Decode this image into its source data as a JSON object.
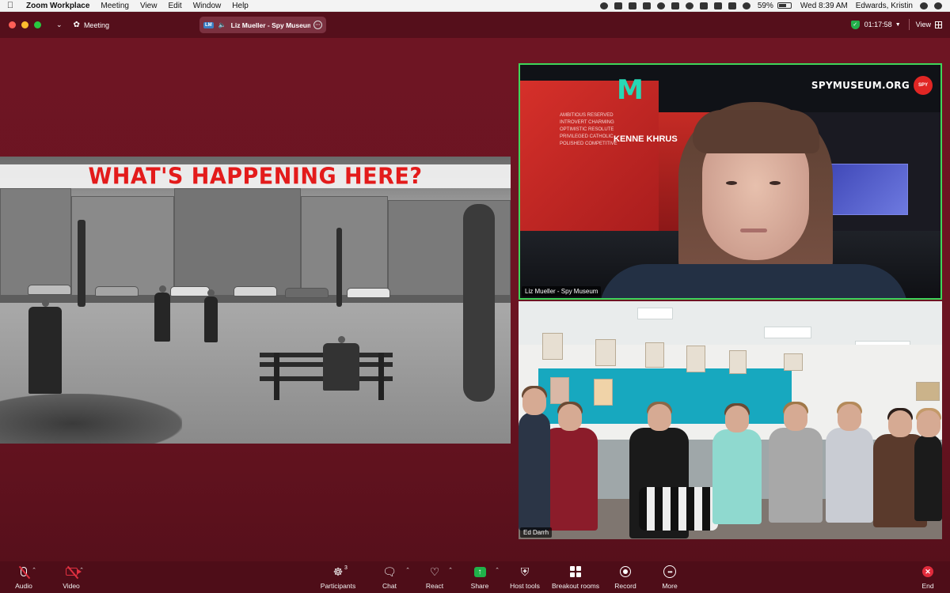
{
  "menubar": {
    "app": "Zoom Workplace",
    "menus": [
      "Meeting",
      "View",
      "Edit",
      "Window",
      "Help"
    ],
    "battery": "59%",
    "clock": "Wed 8:39 AM",
    "user": "Edwards, Kristin"
  },
  "titlebar": {
    "label": "Meeting",
    "pill_initials": "LM",
    "pill_name": "Liz Mueller - Spy Museum",
    "timer": "01:17:58",
    "view_label": "View"
  },
  "slide": {
    "title": "WHAT'S HAPPENING HERE?"
  },
  "tiles": {
    "liz": {
      "name": "Liz Mueller - Spy Museum",
      "logo": "SPYMUSEUM.ORG",
      "logo_badge": "SPY",
      "wall_words": "AMBITIOUS RESERVED INTROVERT CHARMING OPTIMISTIC RESOLUTE PRIVILEGED CATHOLIC POLISHED COMPETITIVE",
      "wall_names": "KENNE KHRUS"
    },
    "ed": {
      "name": "Ed Darrh"
    }
  },
  "toolbar": {
    "audio": "Audio",
    "video": "Video",
    "participants": "Participants",
    "participants_count": "3",
    "chat": "Chat",
    "react": "React",
    "share": "Share",
    "host_tools": "Host tools",
    "breakout": "Breakout rooms",
    "record": "Record",
    "more": "More",
    "end": "End"
  },
  "colors": {
    "stage": "#6e1523",
    "active_speaker_border": "#3fd55a",
    "slide_title": "#e31b1b",
    "end_button": "#e12b3c",
    "share_button": "#20b14a"
  }
}
